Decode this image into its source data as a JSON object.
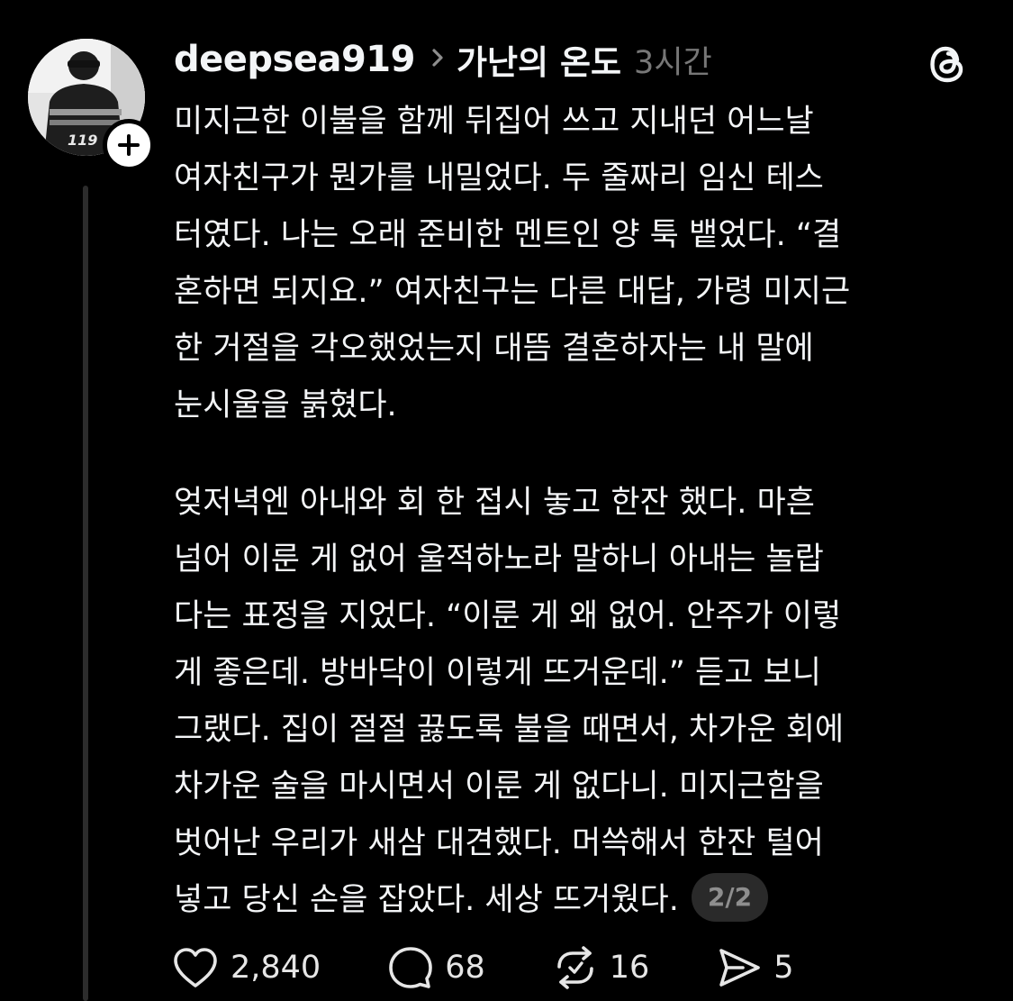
{
  "post": {
    "username": "deepsea919",
    "topic": "가난의 온도",
    "time": "3시간",
    "paragraphs": [
      [
        "미지근한 이불을 함께 뒤집어 쓰고 지내던 어느날",
        "여자친구가 뭔가를 내밀었다. 두 줄짜리 임신 테스",
        "터였다. 나는 오래 준비한 멘트인 양 툭 뱉었다. “결",
        "혼하면 되지요.” 여자친구는 다른 대답, 가령 미지근",
        "한 거절을 각오했었는지 대뜸 결혼하자는 내 말에",
        "눈시울을 붉혔다."
      ],
      [
        "엊저녁엔 아내와 회 한 접시 놓고 한잔 했다. 마흔",
        "넘어 이룬 게 없어 울적하노라 말하니 아내는 놀랍",
        "다는 표정을 지었다. “이룬 게 왜 없어. 안주가 이렇",
        "게 좋은데. 방바닥이 이렇게 뜨거운데.” 듣고 보니",
        "그랬다. 집이 절절 끓도록 불을 때면서, 차가운 회에",
        "차가운 술을 마시면서 이룬 게 없다니. 미지근함을",
        "벗어난 우리가 새삼 대견했다. 머쓱해서 한잔 털어",
        "넣고 당신 손을 잡았다. 세상 뜨거웠다."
      ]
    ],
    "page_indicator": "2/2"
  },
  "actions": {
    "likes": "2,840",
    "comments": "68",
    "reposts": "16",
    "shares": "5"
  },
  "icons": {
    "avatar": "avatar-photo",
    "follow": "plus-icon",
    "app": "threads-logo-icon",
    "chevron": "chevron-right-icon",
    "like": "heart-icon",
    "comment": "comment-bubble-icon",
    "repost": "repost-icon",
    "share": "send-icon"
  },
  "colors": {
    "background": "#000000",
    "text": "#f3f5f7",
    "muted": "#777777",
    "pill": "#2a2a2a",
    "thread_line": "#2c2c2c"
  }
}
